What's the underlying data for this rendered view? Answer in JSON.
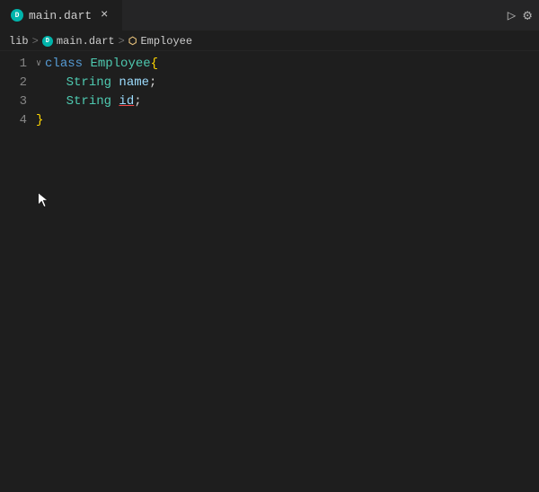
{
  "tab": {
    "icon": "dart",
    "filename": "main.dart",
    "close_label": "×"
  },
  "breadcrumb": {
    "items": [
      {
        "type": "folder",
        "label": "lib"
      },
      {
        "type": "dart",
        "label": "main.dart"
      },
      {
        "type": "class",
        "label": "Employee"
      }
    ]
  },
  "actions": {
    "run": "▷",
    "settings": "⚙"
  },
  "code": {
    "lines": [
      {
        "number": "1",
        "indent": "",
        "tokens": [
          {
            "type": "collapse",
            "text": "∨ "
          },
          {
            "type": "keyword",
            "text": "class "
          },
          {
            "type": "classname",
            "text": "Employee"
          },
          {
            "type": "brace",
            "text": "{"
          }
        ]
      },
      {
        "number": "2",
        "indent": "  ",
        "tokens": [
          {
            "type": "space",
            "text": "    "
          },
          {
            "type": "type",
            "text": "String "
          },
          {
            "type": "varname",
            "text": "name"
          },
          {
            "type": "plain",
            "text": ";"
          }
        ]
      },
      {
        "number": "3",
        "indent": "  ",
        "tokens": [
          {
            "type": "space",
            "text": "    "
          },
          {
            "type": "type",
            "text": "String "
          },
          {
            "type": "varid",
            "text": "id"
          },
          {
            "type": "plain",
            "text": ";"
          }
        ]
      },
      {
        "number": "4",
        "indent": "",
        "tokens": [
          {
            "type": "brace",
            "text": "}"
          }
        ]
      }
    ]
  }
}
